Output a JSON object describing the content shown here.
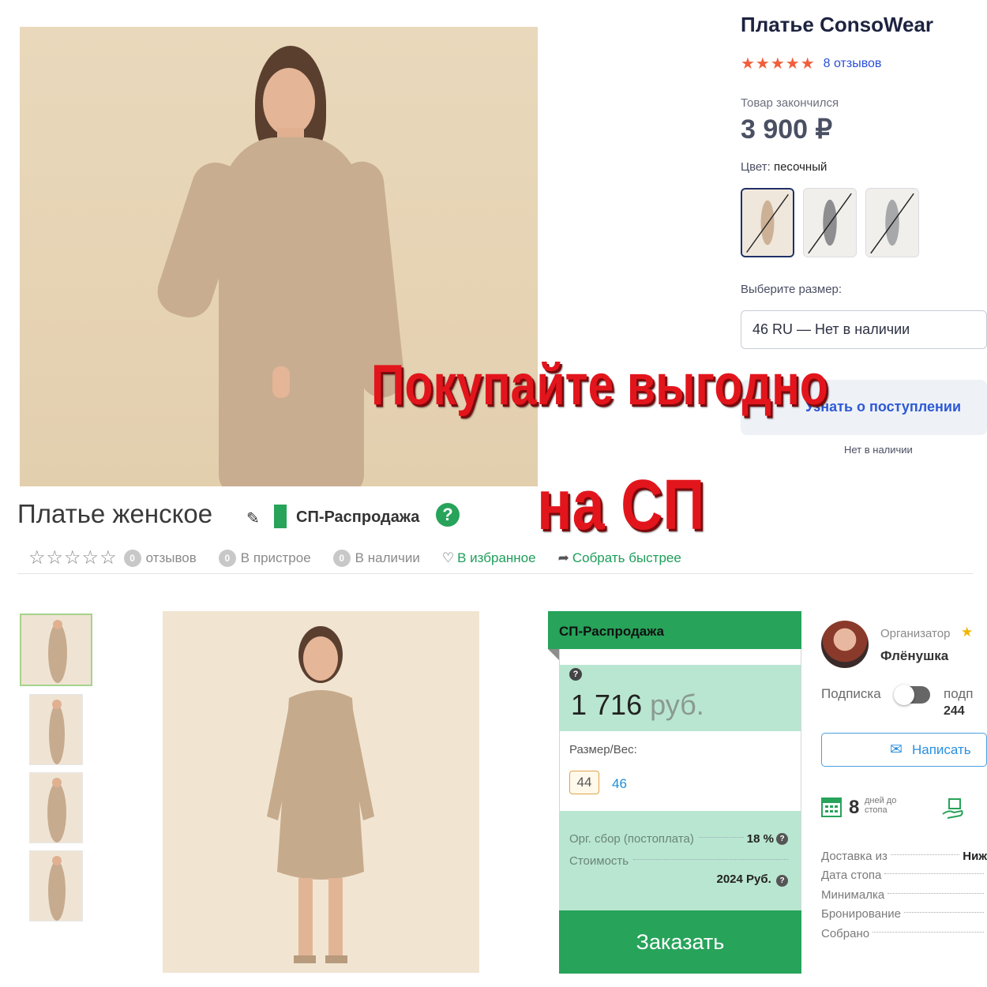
{
  "promo": {
    "line1": "Покупайте выгодно",
    "line2": "на СП"
  },
  "top_product": {
    "title": "Платье ConsoWear",
    "stars": "★★★★★",
    "reviews": "8 отзывов",
    "stock_status": "Товар закончился",
    "price": "3 900 ₽",
    "color_label": "Цвет:",
    "color_value": "песочный",
    "size_label": "Выберите размер:",
    "size_value": "46 RU — Нет в наличии",
    "notify_button": "Узнать о поступлении",
    "notify_note": "Нет в наличии"
  },
  "listing": {
    "title": "Платье женское",
    "badge": "СП-Распродажа",
    "help": "?",
    "meta": {
      "reviews_count": "0",
      "reviews_label": "отзывов",
      "in_stock_build_count": "0",
      "in_stock_build_label": "В пристрое",
      "available_count": "0",
      "available_label": "В наличии",
      "favorite": "В избранное",
      "faster": "Собрать быстрее"
    }
  },
  "order_card": {
    "header": "СП-Распродажа",
    "price_value": "1 716",
    "price_currency": "руб.",
    "size_label": "Размер/Вес:",
    "sizes": [
      "44",
      "46"
    ],
    "org_fee_label": "Орг. сбор (постоплата)",
    "org_fee_value": "18 %",
    "cost_label": "Стоимость",
    "cost_value": "2024 Руб.",
    "order_button": "Заказать"
  },
  "organizer": {
    "label": "Организатор",
    "name": "Флёнушка",
    "subscription_label": "Подписка",
    "subscribers_label": "подп",
    "subscribers_count": "244",
    "write_button": "Написать",
    "days_count": "8",
    "days_label": "дней до стопа",
    "details": [
      {
        "label": "Доставка из",
        "value": "Ниж"
      },
      {
        "label": "Дата стопа",
        "value": ""
      },
      {
        "label": "Минималка",
        "value": ""
      },
      {
        "label": "Бронирование",
        "value": ""
      },
      {
        "label": "Собрано",
        "value": ""
      }
    ]
  },
  "colors": {
    "accent_green": "#27a35a",
    "price_bg": "#b9e6d0",
    "promo_red": "#e3151c",
    "star_orange": "#f05f3b",
    "link_blue": "#2a4fd7"
  }
}
